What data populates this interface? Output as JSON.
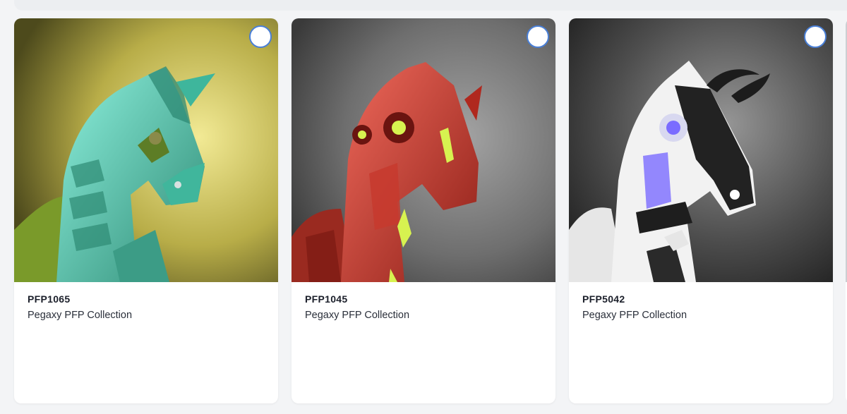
{
  "cards": [
    {
      "id": "PFP1065",
      "collection": "Pegaxy PFP Collection",
      "image": "teal-robot-pegasus-on-yellow",
      "colors": {
        "bg_center": "#f2ea95",
        "bg_edge": "#5d5a22",
        "body": "#55d9c2",
        "body_dark": "#2e8a74",
        "accent": "#7fa33a"
      }
    },
    {
      "id": "PFP1045",
      "collection": "Pegaxy PFP Collection",
      "image": "red-robot-pegasus-on-grey",
      "colors": {
        "bg_center": "#9a9a9a",
        "bg_edge": "#3e3e3e",
        "body": "#e0473a",
        "body_dark": "#8e1f17",
        "accent": "#d7f250"
      }
    },
    {
      "id": "PFP5042",
      "collection": "Pegaxy PFP Collection",
      "image": "white-black-robot-pegasus-on-dark",
      "colors": {
        "bg_center": "#8c8c8c",
        "bg_edge": "#1e1e1e",
        "body": "#f2f2f2",
        "body_dark": "#222222",
        "accent": "#7a6bff"
      }
    }
  ],
  "radio_color": "#4a7fd6"
}
